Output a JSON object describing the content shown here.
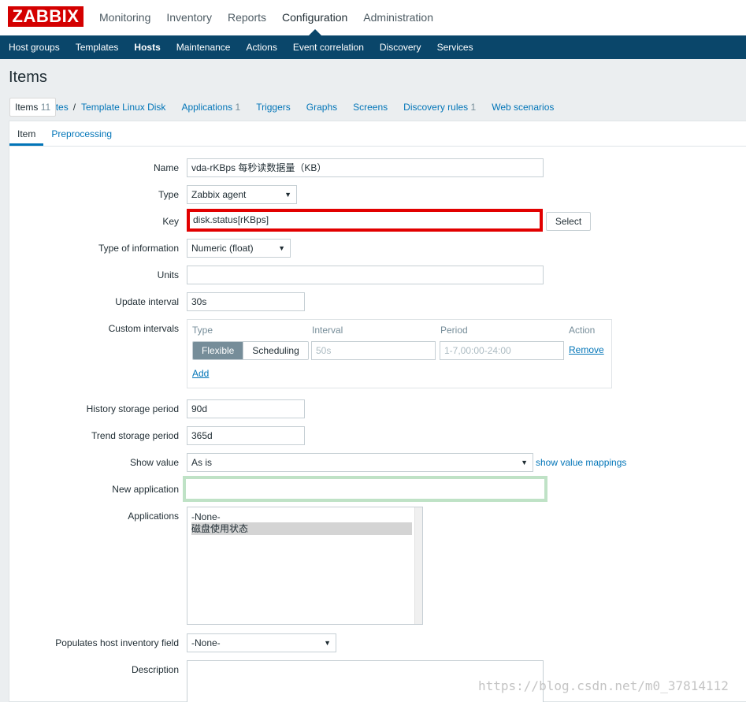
{
  "logo": "ZABBIX",
  "main_menu": [
    "Monitoring",
    "Inventory",
    "Reports",
    "Configuration",
    "Administration"
  ],
  "sub_menu": [
    "Host groups",
    "Templates",
    "Hosts",
    "Maintenance",
    "Actions",
    "Event correlation",
    "Discovery",
    "Services"
  ],
  "page_title": "Items",
  "breadcrumbs": {
    "all_templates": "All templates",
    "separator": "/",
    "template": "Template Linux Disk",
    "applications": "Applications",
    "applications_count": "1",
    "items": "Items",
    "items_count": "11",
    "triggers": "Triggers",
    "graphs": "Graphs",
    "screens": "Screens",
    "discovery_rules": "Discovery rules",
    "discovery_rules_count": "1",
    "web_scenarios": "Web scenarios"
  },
  "form_tabs": [
    "Item",
    "Preprocessing"
  ],
  "form": {
    "name_label": "Name",
    "name_value": "vda-rKBps 每秒读数据量（KB）",
    "type_label": "Type",
    "type_value": "Zabbix agent",
    "key_label": "Key",
    "key_value": "disk.status[rKBps]",
    "select_button": "Select",
    "type_info_label": "Type of information",
    "type_info_value": "Numeric (float)",
    "units_label": "Units",
    "units_value": "",
    "update_interval_label": "Update interval",
    "update_interval_value": "30s",
    "custom_intervals_label": "Custom intervals",
    "custom_intervals": {
      "col_type": "Type",
      "col_interval": "Interval",
      "col_period": "Period",
      "col_action": "Action",
      "flexible": "Flexible",
      "scheduling": "Scheduling",
      "interval_placeholder": "50s",
      "period_placeholder": "1-7,00:00-24:00",
      "remove": "Remove",
      "add": "Add"
    },
    "history_label": "History storage period",
    "history_value": "90d",
    "trend_label": "Trend storage period",
    "trend_value": "365d",
    "show_value_label": "Show value",
    "show_value_value": "As is",
    "show_value_mappings": "show value mappings",
    "new_application_label": "New application",
    "new_application_value": "",
    "applications_label": "Applications",
    "applications_options": [
      "-None-",
      "磁盘使用状态"
    ],
    "inventory_label": "Populates host inventory field",
    "inventory_value": "-None-",
    "description_label": "Description"
  },
  "watermark": "https://blog.csdn.net/m0_37814112",
  "colors": {
    "accent": "#0a466a",
    "link": "#0275b8",
    "logo": "#d40000",
    "highlight_red": "#e20000",
    "highlight_green": "#bfe2c6"
  }
}
